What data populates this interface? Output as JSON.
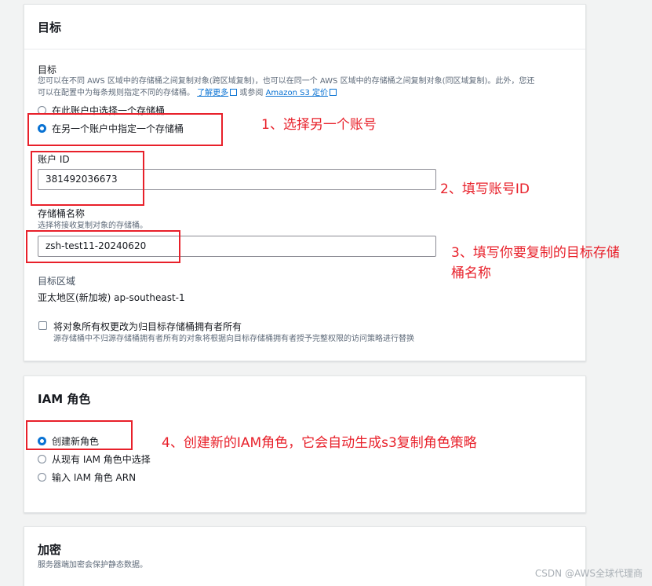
{
  "target_section": {
    "heading": "目标",
    "group_label": "目标",
    "description_line1": "您可以在不同 AWS 区域中的存储桶之间复制对象(跨区域复制)，也可以在同一个 AWS 区域中的存储桶之间复制对象(同区域复制)。此外，您还",
    "description_line2_prefix": "可以在配置中为每条规则指定不同的存储桶。",
    "learn_more": "了解更多",
    "or_see": "或参阅",
    "pricing_link": "Amazon S3 定价",
    "options": [
      {
        "label": "在此账户中选择一个存储桶",
        "selected": false
      },
      {
        "label": "在另一个账户中指定一个存储桶",
        "selected": true
      }
    ],
    "account_id_label": "账户 ID",
    "account_id_value": "381492036673",
    "bucket_name_label": "存储桶名称",
    "bucket_name_hint": "选择将接收复制对象的存储桶。",
    "bucket_name_value": "zsh-test11-20240620",
    "region_label": "目标区域",
    "region_value": "亚太地区(新加坡) ap-southeast-1",
    "ownership_checkbox_label": "将对象所有权更改为归目标存储桶拥有者所有",
    "ownership_checkbox_checked": false,
    "ownership_checkbox_hint": "源存储桶中不归源存储桶拥有者所有的对象将根据向目标存储桶拥有者授予完整权限的访问策略进行替换"
  },
  "iam_section": {
    "heading": "IAM 角色",
    "options": [
      {
        "label": "创建新角色",
        "selected": true
      },
      {
        "label": "从现有 IAM 角色中选择",
        "selected": false
      },
      {
        "label": "输入 IAM 角色 ARN",
        "selected": false
      }
    ]
  },
  "encryption_section": {
    "heading": "加密",
    "description": "服务器端加密会保护静态数据。"
  },
  "annotations": {
    "step1": "1、选择另一个账号",
    "step2": "2、填写账号ID",
    "step3_line1": "3、填写你要复制的目标存储",
    "step3_line2": "桶名称",
    "step4": "4、创建新的IAM角色，它会自动生成s3复制角色策略"
  },
  "watermark": "CSDN @AWS全球代理商",
  "colors": {
    "accent": "#0972d3",
    "annotation_red": "#e8202a",
    "page_bg": "#f2f3f3"
  }
}
